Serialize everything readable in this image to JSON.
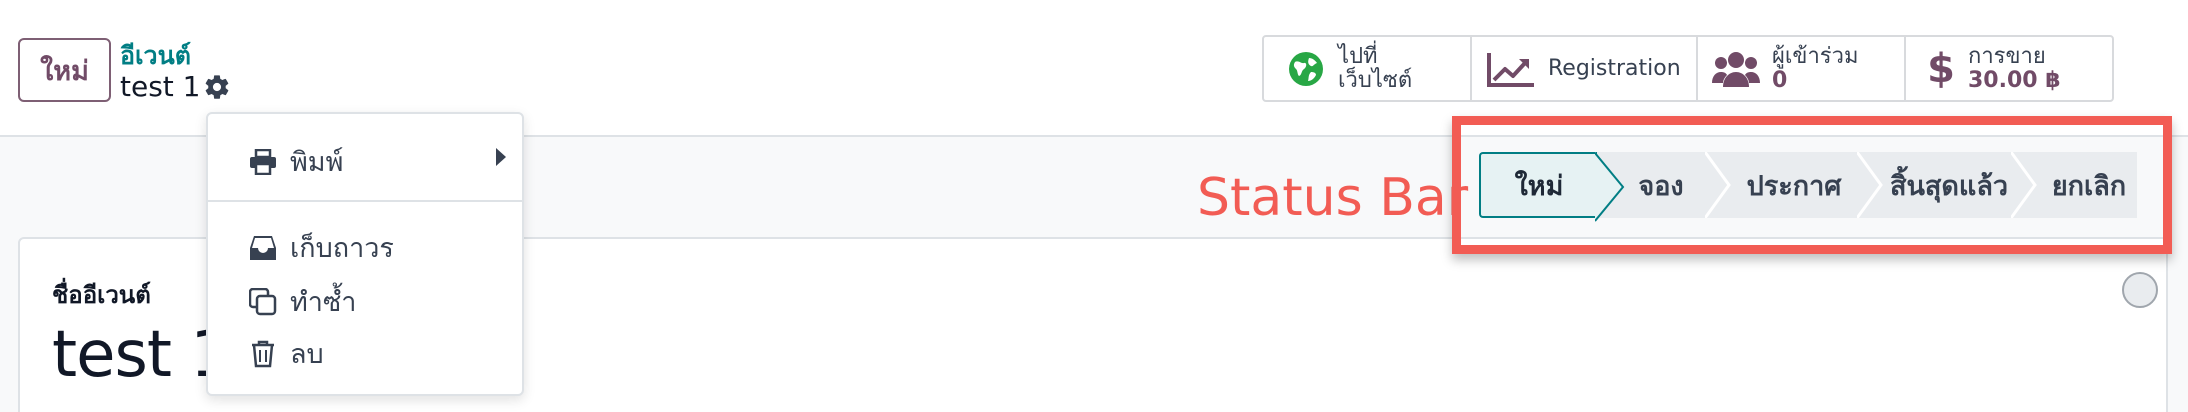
{
  "header": {
    "new_button": "ใหม่",
    "breadcrumb_parent": "อีเวนต์",
    "breadcrumb_current": "test 1"
  },
  "smart_buttons": [
    {
      "line1": "ไปที่",
      "line2": "เว็บไซต์",
      "icon": "globe-icon"
    },
    {
      "label": "Registration",
      "icon": "chart-line-icon"
    },
    {
      "label": "ผู้เข้าร่วม",
      "value": "0",
      "icon": "users-icon"
    },
    {
      "label": "การขาย",
      "value": "30.00 ฿",
      "icon": "dollar-icon"
    }
  ],
  "annotation": {
    "label": "Status Bar"
  },
  "status_bar": {
    "stages": [
      "ใหม่",
      "จอง",
      "ประกาศ",
      "สิ้นสุดแล้ว",
      "ยกเลิก"
    ],
    "active": "ใหม่"
  },
  "form": {
    "name_label": "ชื่ออีเวนต์",
    "name_value": "test 1"
  },
  "action_menu": {
    "print": "พิมพ์",
    "archive": "เก็บถาวร",
    "duplicate": "ทำซ้ำ",
    "delete": "ลบ"
  },
  "colors": {
    "brand": "#714b67",
    "teal": "#017e84",
    "highlight": "#f25c54"
  }
}
